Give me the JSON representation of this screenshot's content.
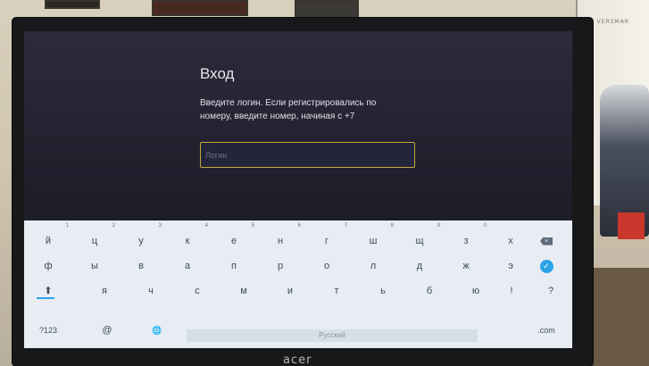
{
  "monitor": {
    "brand_top": "VERSMAR",
    "brand_bottom": "acer"
  },
  "login": {
    "title": "Вход",
    "hint": "Введите логин. Если регистрировались по номеру, введите номер, начиная с +7",
    "placeholder": "Логин"
  },
  "keyboard": {
    "row1": [
      "й",
      "ц",
      "у",
      "к",
      "е",
      "н",
      "г",
      "ш",
      "щ",
      "з",
      "х"
    ],
    "row1_hints": [
      "1",
      "2",
      "3",
      "4",
      "5",
      "6",
      "7",
      "8",
      "9",
      "0",
      ""
    ],
    "row2": [
      "ф",
      "ы",
      "в",
      "а",
      "п",
      "р",
      "о",
      "л",
      "д",
      "ж",
      "э"
    ],
    "row3": [
      "я",
      "ч",
      "с",
      "м",
      "и",
      "т",
      "ь",
      "б",
      "ю",
      "!",
      "?"
    ],
    "row4": {
      "numbers": "?123",
      "at": "@",
      "globe": "🌐",
      "space": "Русский",
      "dotcom": ".com"
    },
    "backspace_icon": "backspace-icon",
    "enter_icon": "check-icon",
    "shift_icon": "shift-icon",
    "accent_color": "#2ba3e6",
    "input_border_color": "#c9a83a"
  }
}
